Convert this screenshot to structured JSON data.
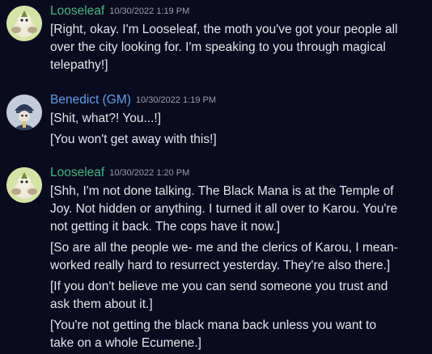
{
  "colors": {
    "background": "#0b0b1f",
    "looseleaf_name": "#43b581",
    "benedict_name": "#5f9ee8",
    "text": "#e3e4ea",
    "timestamp": "#9a9cab"
  },
  "messages": [
    {
      "author": "Looseleaf",
      "timestamp": "10/30/2022 1:19 PM",
      "avatar_icon": "moth-avatar-icon",
      "lines": [
        "[Right, okay. I'm Looseleaf, the moth you've got your people all",
        "over the city looking for. I'm speaking to you through magical",
        "telepathy!]"
      ]
    },
    {
      "author": "Benedict (GM)",
      "timestamp": "10/30/2022 1:19 PM",
      "avatar_icon": "knight-avatar-icon",
      "lines": [
        "[Shit, what?! You...!]",
        "[You won't get away with this!]"
      ]
    },
    {
      "author": "Looseleaf",
      "timestamp": "10/30/2022 1:20 PM",
      "avatar_icon": "moth-avatar-icon",
      "lines": [
        "[Shh, I'm not done talking. The Black Mana is at the Temple of",
        "Joy. Not hidden or anything. I turned it all over to Karou. You're",
        "not getting it back. The cops have it now.]",
        "[So are all the people we- me and the clerics of Karou, I mean-",
        "worked really hard to resurrect yesterday. They're also there.]",
        "[If you don't believe me you can send someone you trust and",
        "ask them about it.]",
        "[You're not getting the black mana back unless you want to",
        "take on a whole Ecumene.]"
      ]
    }
  ]
}
